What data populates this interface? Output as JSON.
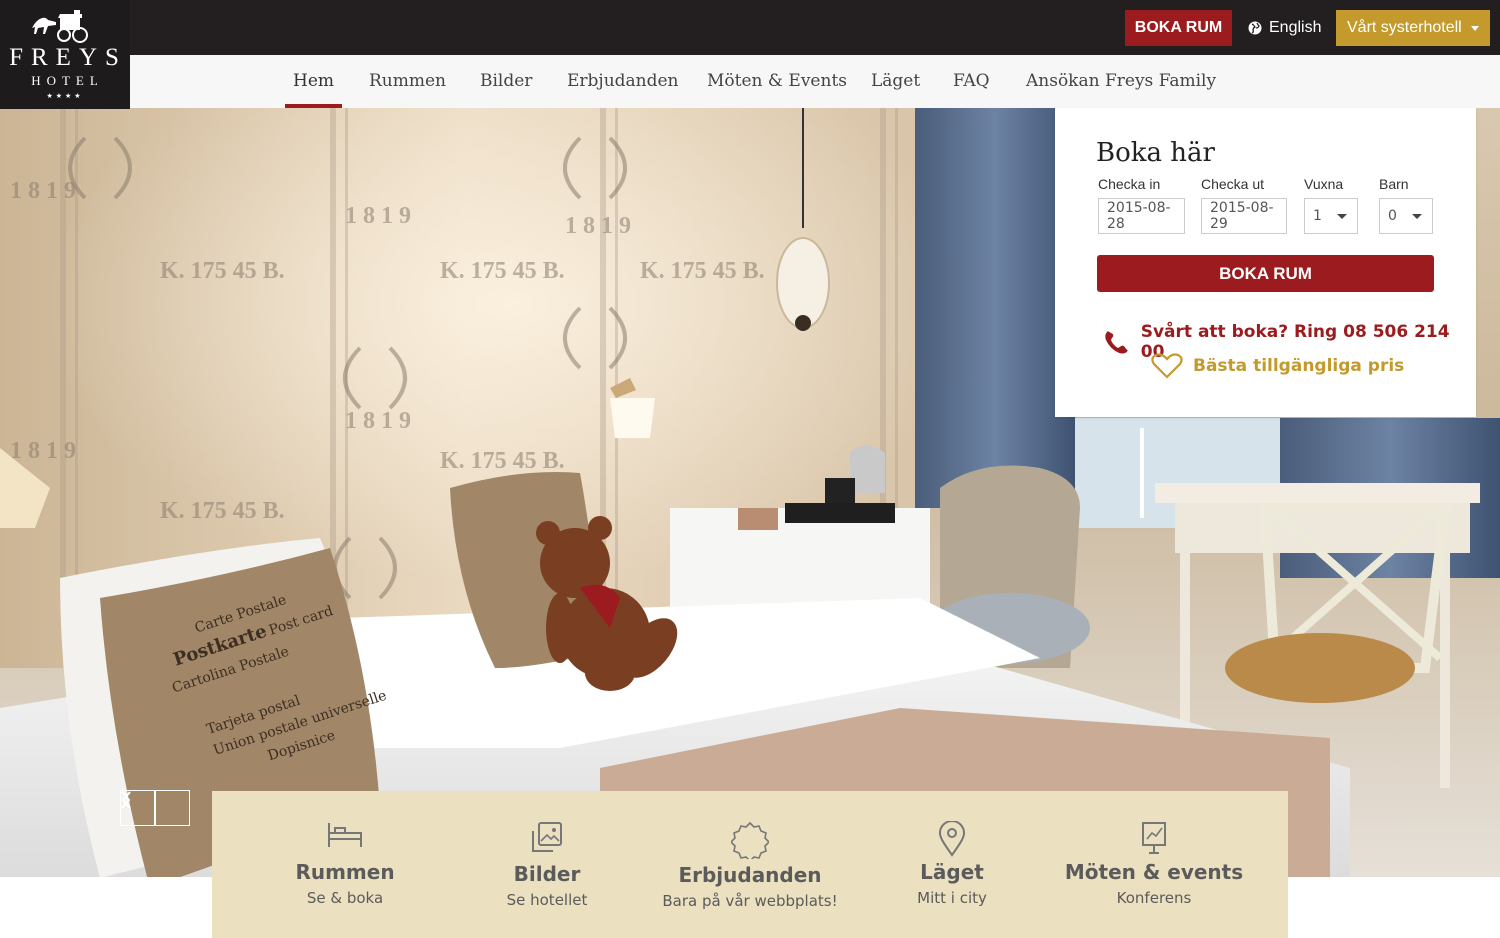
{
  "logo": {
    "brand": "FREYS",
    "sub": "HOTEL",
    "stars": "★★★★"
  },
  "topbar": {
    "book_label": "BOKA RUM",
    "language": "English",
    "sister_label": "Vårt systerhotell"
  },
  "nav": {
    "items": [
      {
        "label": "Hem",
        "active": true
      },
      {
        "label": "Rummen"
      },
      {
        "label": "Bilder"
      },
      {
        "label": "Erbjudanden"
      },
      {
        "label": "Möten & Events"
      },
      {
        "label": "Läget"
      },
      {
        "label": "FAQ"
      },
      {
        "label": "Ansökan Freys Family"
      }
    ]
  },
  "booking": {
    "title": "Boka här",
    "checkin_label": "Checka in",
    "checkin_value": "2015-08-28",
    "checkout_label": "Checka ut",
    "checkout_value": "2015-08-29",
    "adults_label": "Vuxna",
    "adults_value": "1",
    "children_label": "Barn",
    "children_value": "0",
    "book_label": "BOKA RUM",
    "phone_text": "Svårt att boka? Ring 08 506 214 00",
    "price_text": "Bästa tillgängliga pris"
  },
  "features": [
    {
      "title": "Rummen",
      "subtitle": "Se & boka",
      "icon": "bed-icon"
    },
    {
      "title": "Bilder",
      "subtitle": "Se hotellet",
      "icon": "photos-icon"
    },
    {
      "title": "Erbjudanden",
      "subtitle": "Bara på vår webbplats!",
      "icon": "badge-icon"
    },
    {
      "title": "Läget",
      "subtitle": "Mitt i city",
      "icon": "map-pin-icon"
    },
    {
      "title": "Möten & events",
      "subtitle": "Konferens",
      "icon": "presentation-chart-icon"
    }
  ],
  "hero": {
    "wallpaper_texts": [
      "1 8 1 9",
      "K. 175 45 B."
    ],
    "pillow_texts": [
      "Carte Postale",
      "Postkarte",
      "Post card",
      "Cartolina Postale",
      "Tarjeta postal",
      "Union postale universelle",
      "Dopisnice"
    ]
  },
  "colors": {
    "brand_red": "#9b1b1e",
    "gold": "#c49a2c",
    "topbar": "#231f20",
    "feature_bg": "#ebe0c0"
  }
}
